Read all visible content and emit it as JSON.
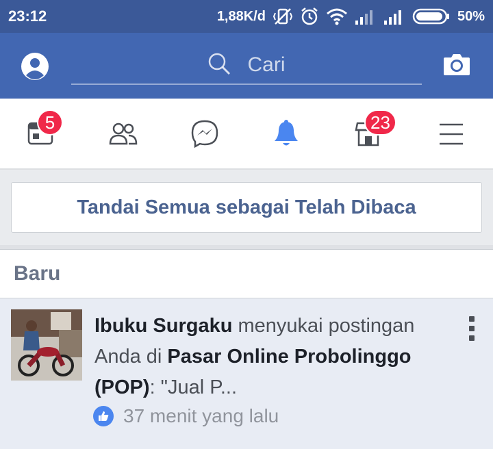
{
  "status_bar": {
    "time": "23:12",
    "network_speed": "1,88K/d",
    "battery_percent": "50%",
    "icons": [
      "vibrate-off-icon",
      "alarm-icon",
      "wifi-icon",
      "signal-icon",
      "signal-icon",
      "battery-icon"
    ]
  },
  "search": {
    "placeholder": "Cari"
  },
  "tabs": {
    "feed_badge": "5",
    "marketplace_badge": "23",
    "icons": [
      "news-feed-icon",
      "friends-icon",
      "messenger-icon",
      "bell-icon",
      "marketplace-icon",
      "menu-icon"
    ],
    "active": "notifications"
  },
  "mark_all_read": "Tandai Semua sebagai Telah Dibaca",
  "section": {
    "title": "Baru"
  },
  "notification": {
    "actor": "Ibuku Surgaku",
    "action": " menyukai postingan Anda di ",
    "group": "Pasar Online Probolinggo (POP)",
    "snippet": ": \"Jual P...",
    "time": "37 menit yang lalu"
  },
  "colors": {
    "header": "#4267b2",
    "status_bar": "#3b5998",
    "badge": "#f02849",
    "active_tab": "#4a86f0"
  }
}
